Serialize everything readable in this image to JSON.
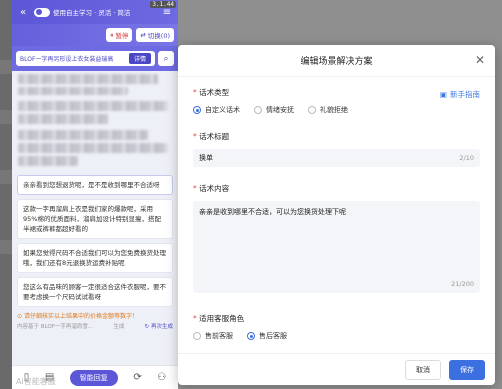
{
  "plugin": {
    "version": "3.1.44",
    "toggle_label": "使用自主学习 · 灵活 · 简洁",
    "btn_pause": "暂停",
    "btn_switch": "切换(0)",
    "search_text": "BLOF一字再另形设上衣女装益瑞高",
    "search_btn": "详情",
    "cards": [
      "亲亲看到您想退货呢，是不是收到哪里不合适呀",
      "这款一字再溜肩上衣是我们家的爆款呢，采用95%棉的优质面料，溜肩加设计特别显瘦，搭配半裙或裤裤都超好看的",
      "如果您觉得尺码不合适我们可以为您免费换货处理哦，我们还有8元退换货运费补贴呢",
      "您这么有品味的顾客一定很适合这件衣服呢，要不要考虑换一个尺码试试看呀"
    ],
    "tip": "请仔细核实以上结果中的价格金额等数字！",
    "meta_left": "内容基于 BLOF一字再溜肩雪...",
    "meta_mid": "生成",
    "meta_right": "再次生成",
    "smart_btn": "智能回复",
    "watermark": "Ai智能客服"
  },
  "modal": {
    "title": "编辑场景解决方案",
    "guide": "新手指南",
    "type_label": "话术类型",
    "type_options": [
      "自定义话术",
      "情绪安抚",
      "礼貌拒绝"
    ],
    "type_selected": 0,
    "title_label": "话术标题",
    "title_value": "换单",
    "title_count": "2/10",
    "content_label": "话术内容",
    "content_value": "亲亲是收到哪里不合适，可以为您换货处理下呢",
    "content_count": "21/200",
    "role_label": "适用客服角色",
    "role_options": [
      "售前客服",
      "售后客服"
    ],
    "role_selected": 1,
    "cancel": "取消",
    "save": "保存"
  },
  "colors": {
    "brand": "#5b57d6",
    "primary": "#3c6fe0",
    "required": "#e34d4d",
    "warning": "#e07b1f"
  }
}
